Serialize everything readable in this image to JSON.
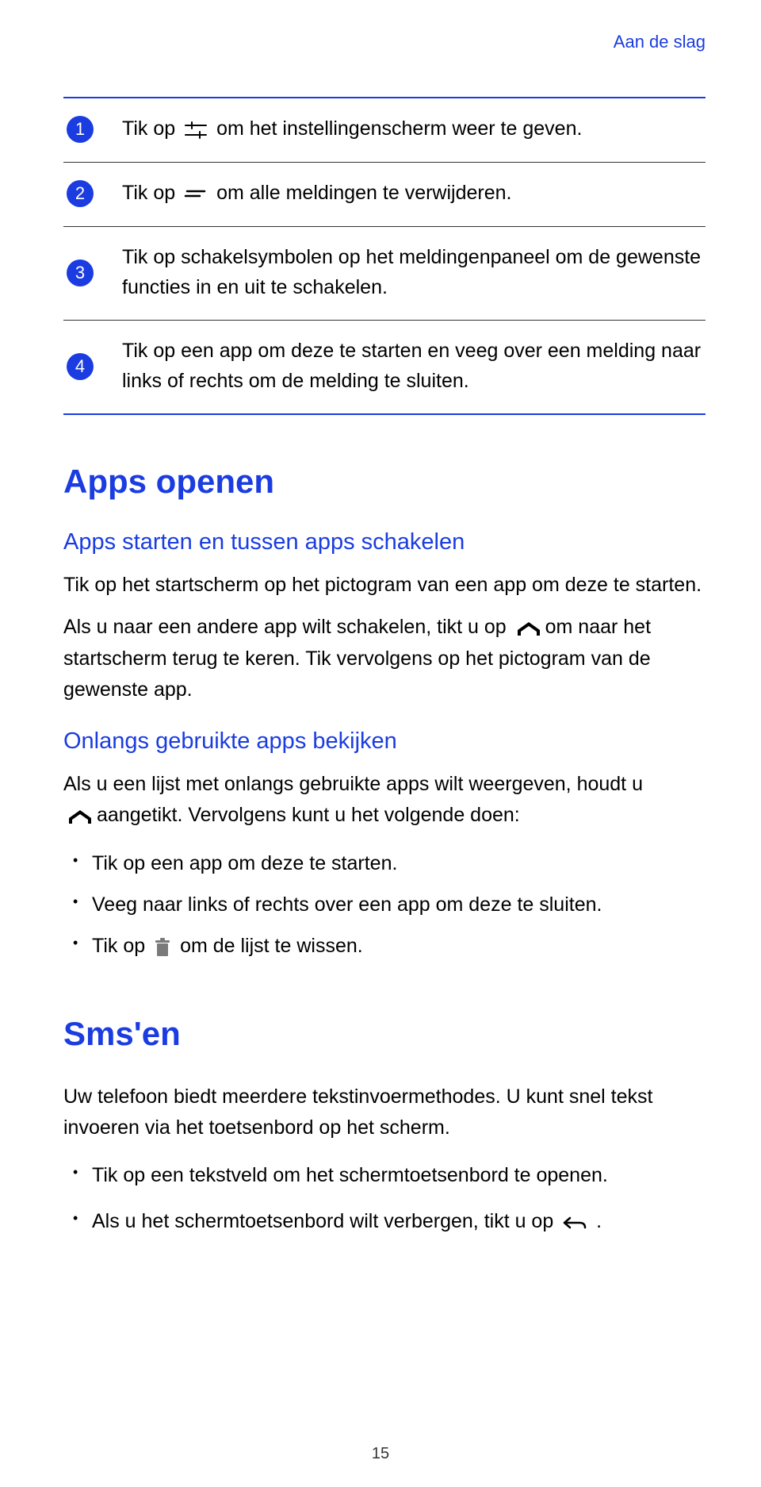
{
  "pageHeader": "Aan de slag",
  "steps": [
    {
      "num": "1",
      "pre": "Tik op ",
      "post": "om het instellingenscherm weer te geven.",
      "icon": "settings-sliders"
    },
    {
      "num": "2",
      "pre": "Tik op ",
      "post": "om alle meldingen te verwijderen.",
      "icon": "clear-stack"
    },
    {
      "num": "3",
      "pre": "",
      "post": "Tik op schakelsymbolen op het meldingenpaneel om de gewenste functies in en uit te schakelen.",
      "icon": null
    },
    {
      "num": "4",
      "pre": "",
      "post": "Tik op een app om deze te starten en veeg over een melding naar links of rechts om de melding te sluiten.",
      "icon": null
    }
  ],
  "sectionApps": {
    "title": "Apps openen",
    "sub1": "Apps starten en tussen apps schakelen",
    "p1": "Tik op het startscherm op het pictogram van een app om deze te starten.",
    "p2a": "Als u naar een andere app wilt schakelen, tikt u op ",
    "p2b": "om naar het startscherm terug te keren. Tik vervolgens op het pictogram van de gewenste app.",
    "sub2": "Onlangs gebruikte apps bekijken",
    "p3a": "Als u een lijst met onlangs gebruikte apps wilt weergeven, houdt u",
    "p3b": "aangetikt. Vervolgens kunt u het volgende doen:",
    "bullets": [
      "Tik op een app om deze te starten.",
      "Veeg naar links of rechts over een app om deze te sluiten."
    ],
    "b3a": "Tik op ",
    "b3b": " om de lijst te wissen."
  },
  "sectionSms": {
    "title": "Sms'en",
    "p1": "Uw telefoon biedt meerdere tekstinvoermethodes. U kunt snel tekst invoeren via het toetsenbord op het scherm.",
    "bullets": [
      "Tik op een tekstveld om het schermtoetsenbord te openen."
    ],
    "b2a": "Als u het schermtoetsenbord wilt verbergen, tikt u op ",
    "b2b": "."
  },
  "pageNumber": "15"
}
